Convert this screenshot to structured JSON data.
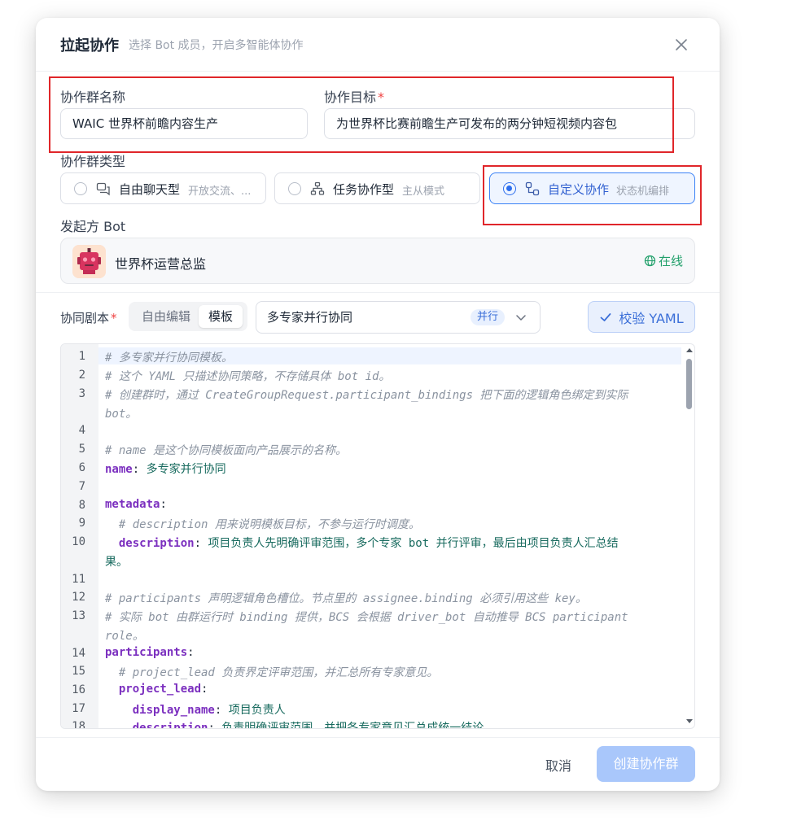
{
  "dialog": {
    "title": "拉起协作",
    "subtitle": "选择 Bot 成员，开启多智能体协作"
  },
  "form": {
    "group_name_label": "协作群名称",
    "group_name_value": "WAIC 世界杯前瞻内容生产",
    "goal_label": "协作目标",
    "goal_value": "为世界杯比赛前瞻生产可发布的两分钟短视频内容包",
    "required_mark": "*",
    "type_label": "协作群类型",
    "types": [
      {
        "label": "自由聊天型",
        "desc": "开放交流、...",
        "icon": "chat-icon",
        "selected": false
      },
      {
        "label": "任务协作型",
        "desc": "主从模式",
        "icon": "hierarchy-icon",
        "selected": false
      },
      {
        "label": "自定义协作",
        "desc": "状态机编排",
        "icon": "workflow-icon",
        "selected": true
      }
    ],
    "initiator_label": "发起方 Bot",
    "bot_name": "世界杯运营总监",
    "bot_status": "在线",
    "script_label": "协同剧本",
    "mode_tabs": [
      "自由编辑",
      "模板"
    ],
    "active_mode": "模板",
    "template_value": "多专家并行协同",
    "template_tag": "并行",
    "validate_label": "校验 YAML"
  },
  "editor": {
    "lines": [
      "1",
      "2",
      "3",
      "",
      "4",
      "5",
      "6",
      "7",
      "8",
      "9",
      "10",
      "",
      "11",
      "12",
      "13",
      "",
      "14",
      "15",
      "16",
      "17",
      "18"
    ],
    "code": [
      "# 多专家并行协同模板。",
      "# 这个 YAML 只描述协同策略，不存储具体 bot id。",
      "# 创建群时，通过 CreateGroupRequest.participant_bindings 把下面的逻辑角色绑定到实际",
      "bot。",
      "",
      "# name 是这个协同模板面向产品展示的名称。",
      "name",
      "多专家并行协同",
      "",
      "metadata",
      "  # description 用来说明模板目标，不参与运行时调度。",
      "  description",
      "项目负责人先明确评审范围，多个专家 bot 并行评审，最后由项目负责人汇总结",
      "果。",
      "",
      "# participants 声明逻辑角色槽位。节点里的 assignee.binding 必须引用这些 key。",
      "# 实际 bot 由群运行时 binding 提供，BCS 会根据 driver_bot 自动推导 BCS participant",
      "role。",
      "participants",
      "  # project_lead 负责界定评审范围，并汇总所有专家意见。",
      "  project_lead",
      "    display_name",
      "项目负责人",
      "    description",
      "负责明确评审范围，并把各专家意见汇总成统一结论。"
    ]
  },
  "footer": {
    "cancel_label": "取消",
    "create_label": "创建协作群"
  },
  "colors": {
    "primary": "#2f6fed",
    "online": "#22a06b",
    "required": "#ef4444",
    "highlight_box": "#e0262a",
    "create_disabled": "#a9c7fb"
  }
}
